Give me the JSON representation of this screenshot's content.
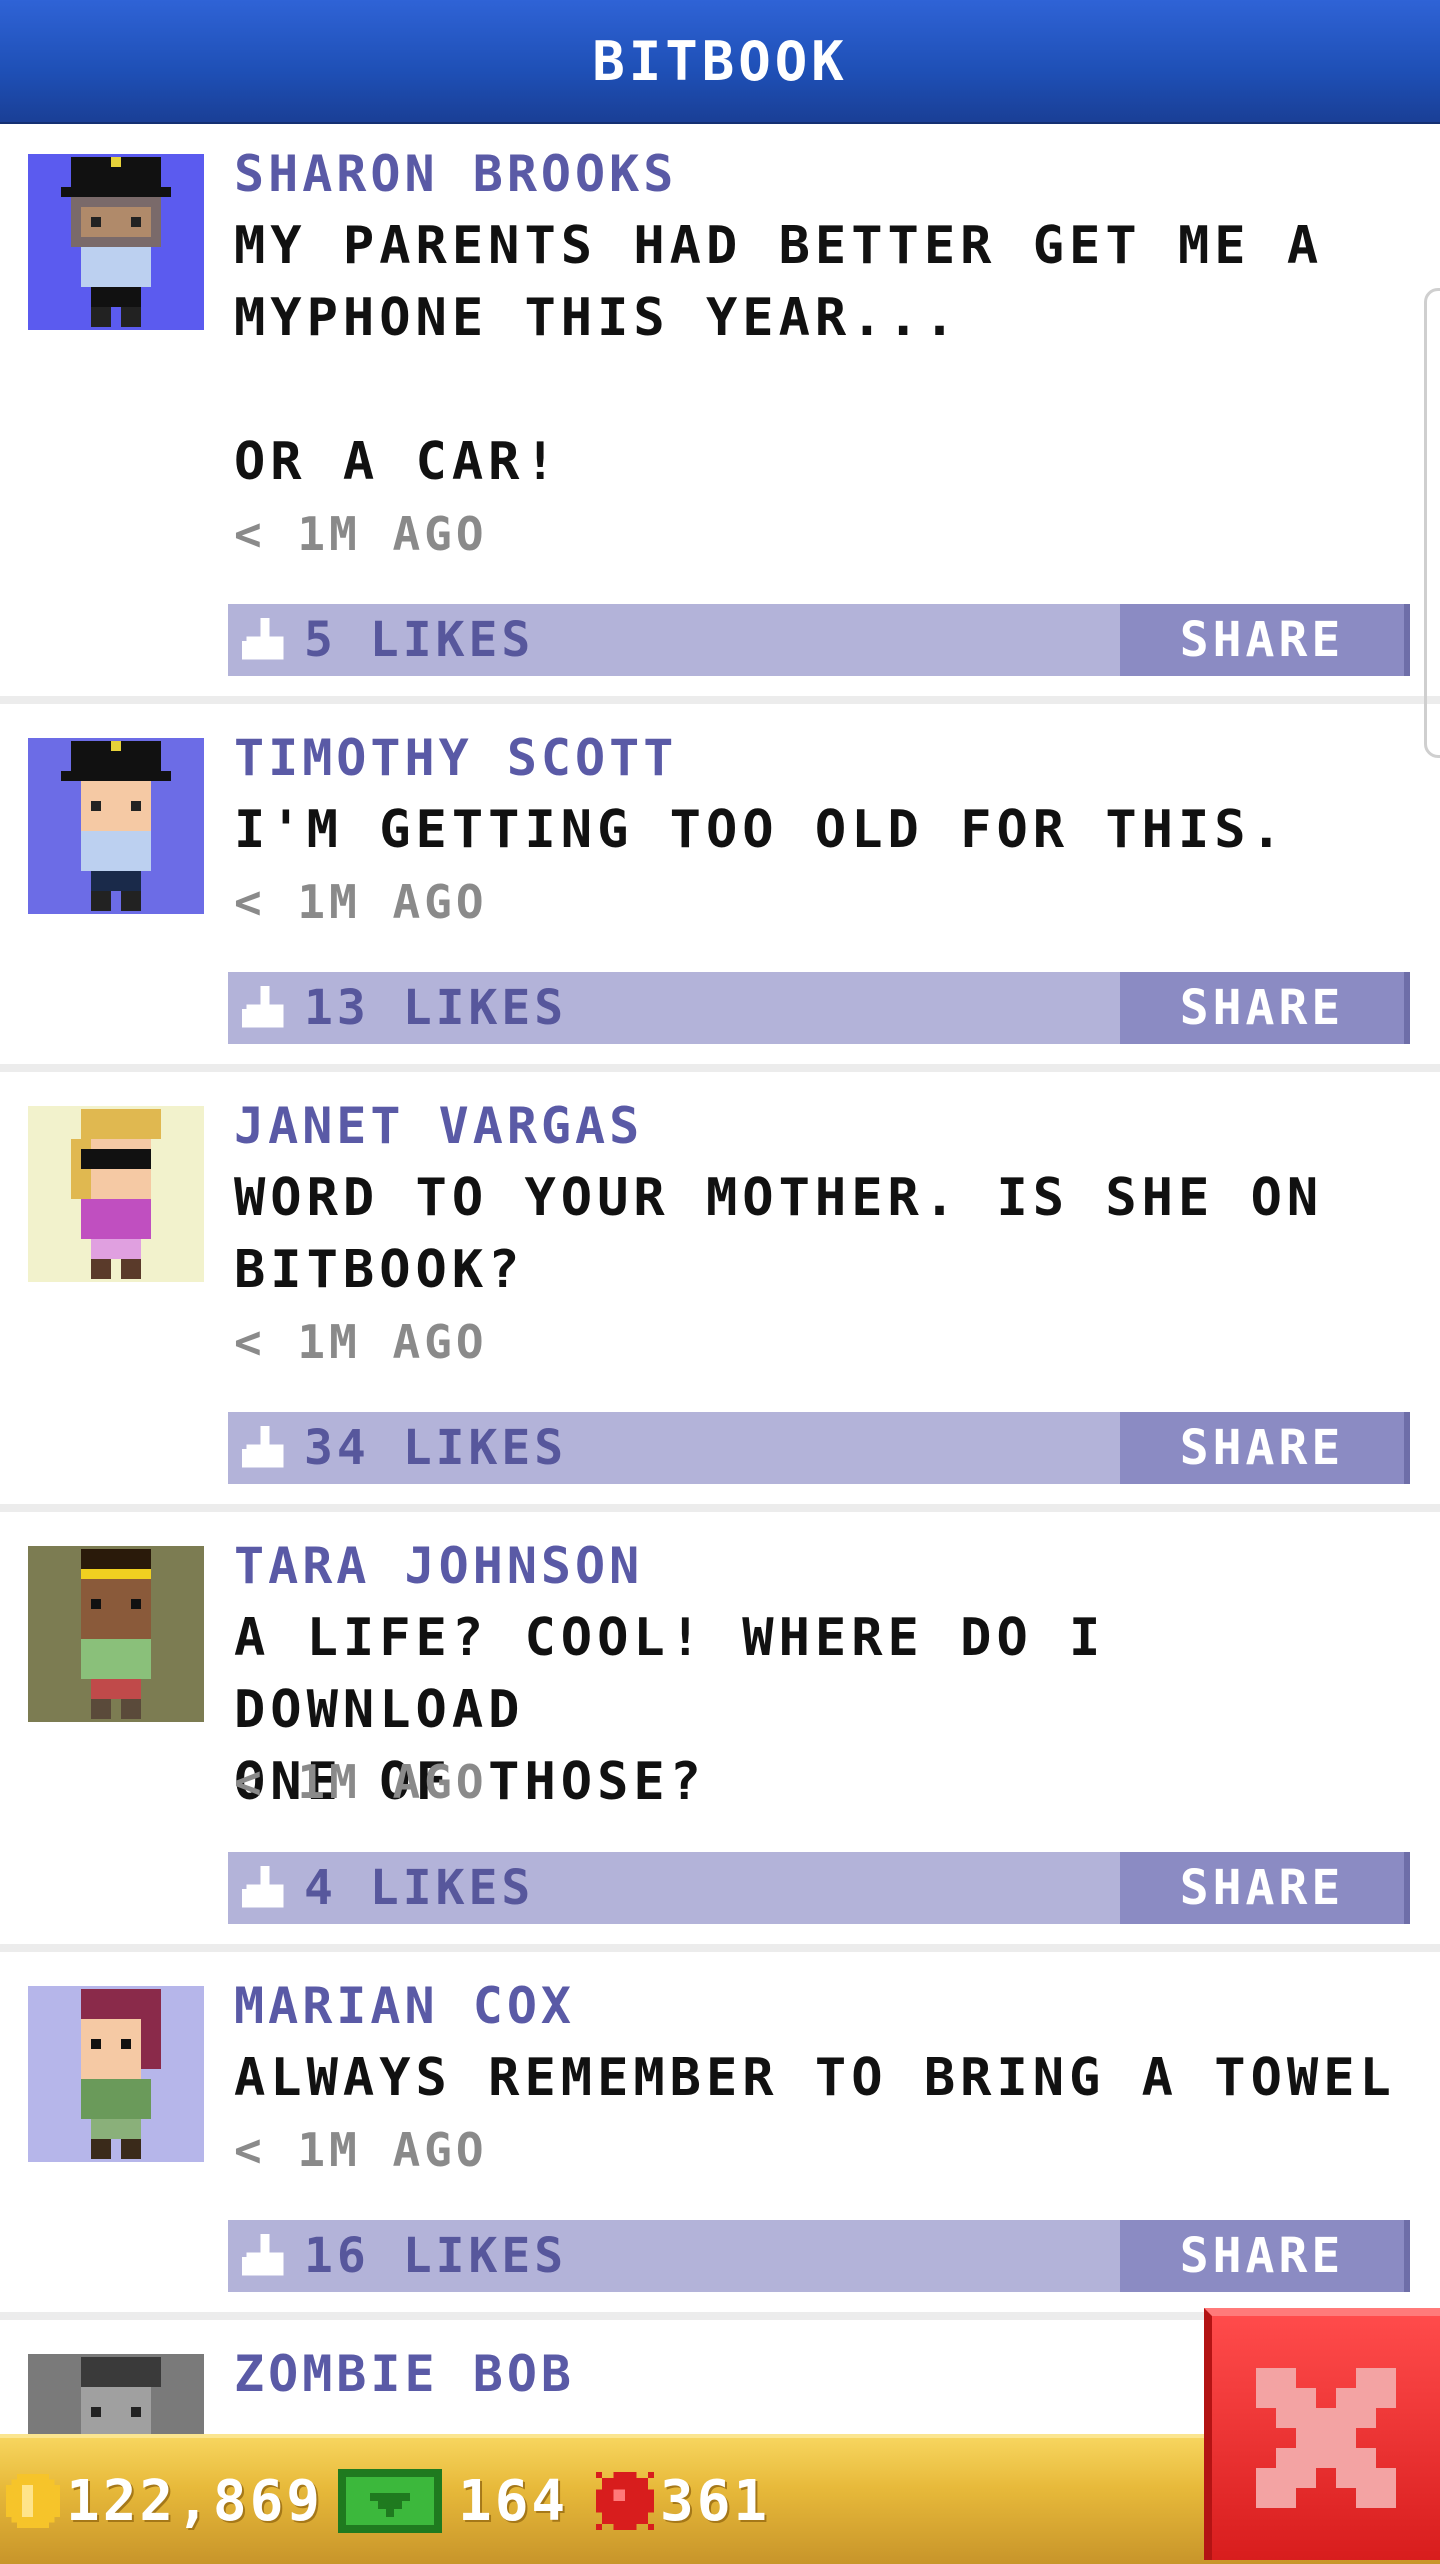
{
  "header": {
    "title": "BITBOOK"
  },
  "posts": [
    {
      "name": "SHARON BROOKS",
      "message": "MY PARENTS HAD BETTER GET ME A\nMYPHONE THIS YEAR...\n\nOR A CAR!",
      "time": "< 1M AGO",
      "likes": "5 LIKES",
      "share": "SHARE",
      "avatar_bg": "#5b5bef",
      "avatar_name": "police-officer-avatar"
    },
    {
      "name": "TIMOTHY SCOTT",
      "message": "I'M GETTING TOO OLD FOR THIS.",
      "time": "< 1M AGO",
      "likes": "13 LIKES",
      "share": "SHARE",
      "avatar_bg": "#6c6ce6",
      "avatar_name": "police-officer-avatar"
    },
    {
      "name": "JANET VARGAS",
      "message": "WORD TO YOUR MOTHER. IS SHE ON\nBITBOOK?",
      "time": "< 1M AGO",
      "likes": "34 LIKES",
      "share": "SHARE",
      "avatar_bg": "#f2f2cc",
      "avatar_name": "sunglasses-woman-avatar"
    },
    {
      "name": "TARA JOHNSON",
      "message": "A LIFE? COOL! WHERE DO I DOWNLOAD\nONE OF THOSE?",
      "time": "< 1M AGO",
      "likes": "4 LIKES",
      "share": "SHARE",
      "avatar_bg": "#7c7c52",
      "avatar_name": "headband-woman-avatar"
    },
    {
      "name": "MARIAN COX",
      "message": "ALWAYS REMEMBER TO BRING A TOWEL",
      "time": "< 1M AGO",
      "likes": "16 LIKES",
      "share": "SHARE",
      "avatar_bg": "#b6b6ea",
      "avatar_name": "red-hair-woman-avatar"
    },
    {
      "name": "ZOMBIE BOB",
      "message": "",
      "time": "",
      "likes": "",
      "share": "",
      "avatar_bg": "#7a7a7a",
      "avatar_name": "zombie-avatar"
    }
  ],
  "bottom_bar": {
    "coins": "122,869",
    "bux": "164",
    "gems": "361"
  },
  "colors": {
    "header": "#1e4fb5",
    "name": "#5a5aa6",
    "bar": "#b3b3d9",
    "share": "#8b8bc3",
    "bottom": "#e7b93a",
    "close": "#e02424"
  },
  "icons": {
    "coin": "coin-icon",
    "bux": "bux-icon",
    "gem": "gem-icon",
    "close": "close-icon",
    "like": "thumbs-up-icon"
  }
}
